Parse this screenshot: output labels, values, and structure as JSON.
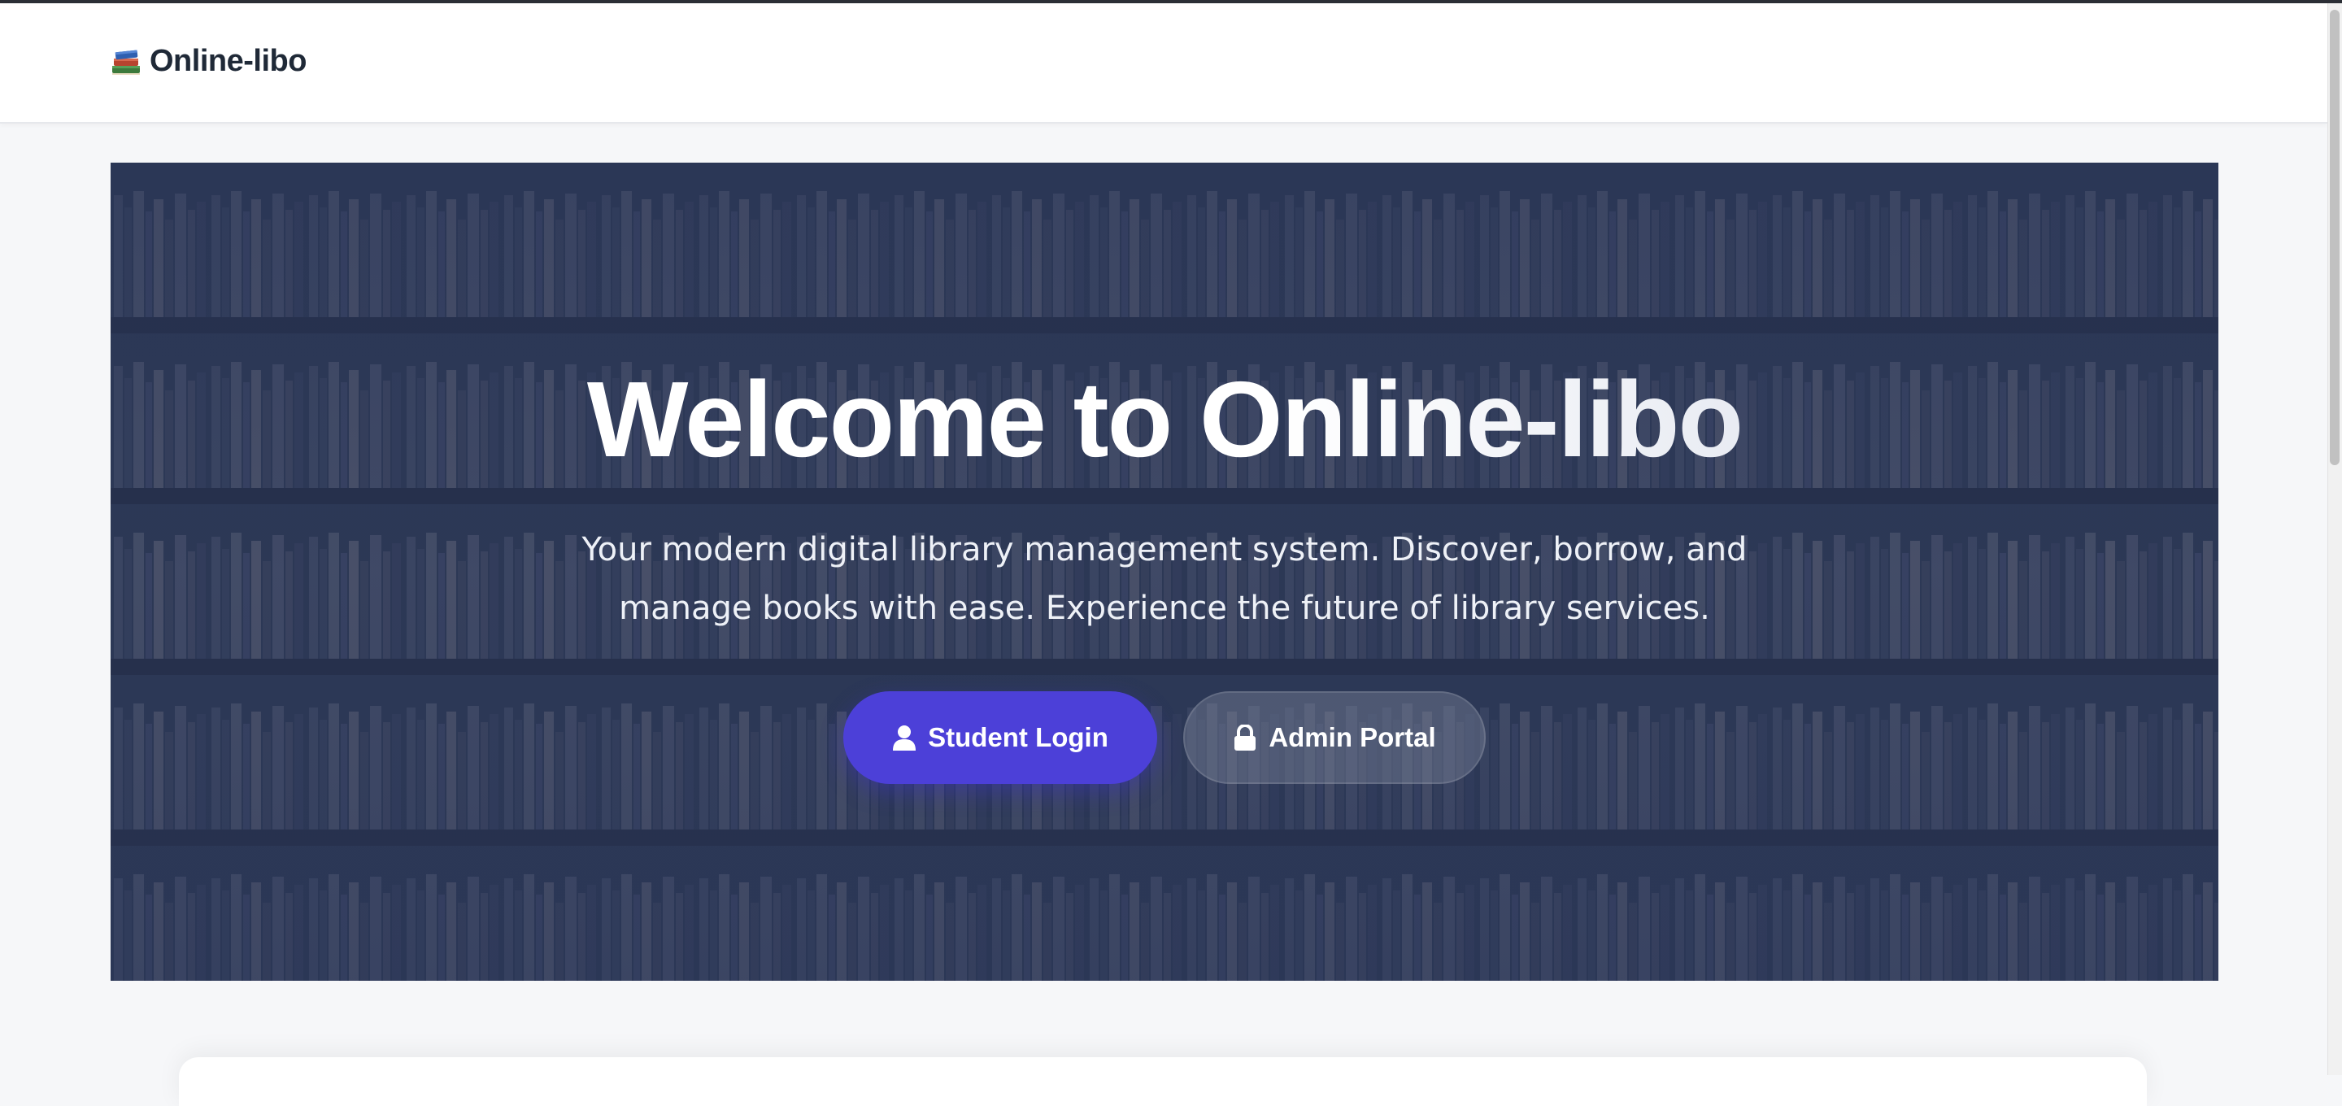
{
  "navbar": {
    "brand_icon": "books-icon",
    "brand_name": "Online-libo"
  },
  "hero": {
    "title": "Welcome to Online-libo",
    "subtitle": "Your modern digital library management system. Discover, borrow, and manage books with ease. Experience the future of library services.",
    "primary_button": {
      "label": "Student Login",
      "icon": "user-icon"
    },
    "secondary_button": {
      "label": "Admin Portal",
      "icon": "lock-icon"
    }
  },
  "colors": {
    "accent": "#4c40d8",
    "hero_overlay": "#2c3855",
    "brand_text": "#1f2937"
  }
}
